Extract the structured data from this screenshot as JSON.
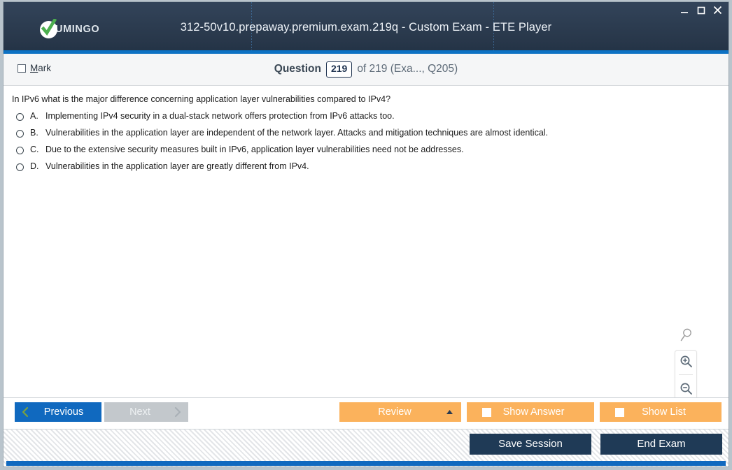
{
  "window": {
    "title": "312-50v10.prepaway.premium.exam.219q - Custom Exam - ETE Player",
    "brand": "UMINGO",
    "controls": {
      "minimize": "–",
      "maximize": "☐",
      "close": "✕"
    }
  },
  "question_header": {
    "mark_label_first": "M",
    "mark_label_rest": "ark",
    "question_label": "Question",
    "question_number": "219",
    "of_text": "of 219 (Exa..., Q205)"
  },
  "question": {
    "text": "In IPv6 what is the major difference concerning application layer vulnerabilities compared to IPv4?",
    "options": [
      {
        "letter": "A.",
        "text": "Implementing IPv4 security in a dual-stack network offers protection from IPv6 attacks too."
      },
      {
        "letter": "B.",
        "text": "Vulnerabilities in the application layer are independent of the network layer. Attacks and mitigation techniques are almost identical."
      },
      {
        "letter": "C.",
        "text": "Due to the extensive security measures built in IPv6, application layer vulnerabilities need not be addresses."
      },
      {
        "letter": "D.",
        "text": "Vulnerabilities in the application layer are greatly different from IPv4."
      }
    ]
  },
  "zoom_tools": {
    "magnifier": "magnifier-icon",
    "zoom_in": "zoom-in-icon",
    "zoom_out": "zoom-out-icon"
  },
  "navbar": {
    "previous": "Previous",
    "next": "Next",
    "review": "Review",
    "show_answer": "Show Answer",
    "show_list": "Show List"
  },
  "footer": {
    "save_session": "Save Session",
    "end_exam": "End Exam"
  },
  "colors": {
    "titlebar": "#2c3c50",
    "accent_blue": "#1069bf",
    "orange": "#fbb25c",
    "dark_navy": "#1f3a56",
    "logo_green": "#4caf4f"
  }
}
